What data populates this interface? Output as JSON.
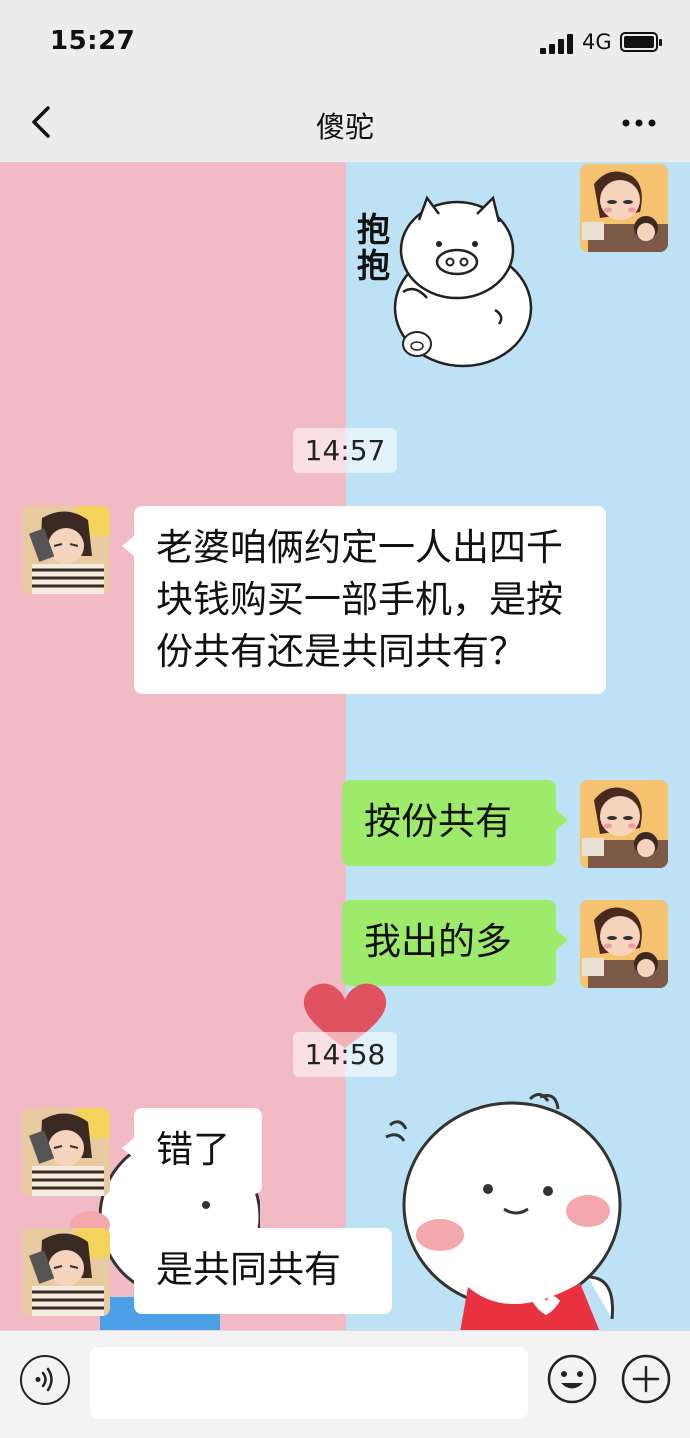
{
  "status_bar": {
    "time": "15:27",
    "network": "4G"
  },
  "nav": {
    "title": "傻驼"
  },
  "messages": {
    "m1_text": "老婆咱俩约定一人出四千块钱购买一部手机，是按份共有还是共同共有？",
    "m2_text": "按份共有",
    "m3_text": "我出的多",
    "m4_text": "错了",
    "m5_text": "是共同共有"
  },
  "timestamps": {
    "t1": "14:57",
    "t2": "14:58"
  },
  "sticker": {
    "text": "抱抱"
  },
  "input": {
    "value": ""
  },
  "colors": {
    "left_background": "#f2bac5",
    "right_background": "#bde2f5",
    "sent_bubble": "#9eea6a",
    "received_bubble": "#ffffff",
    "heart": "#e0525f"
  }
}
